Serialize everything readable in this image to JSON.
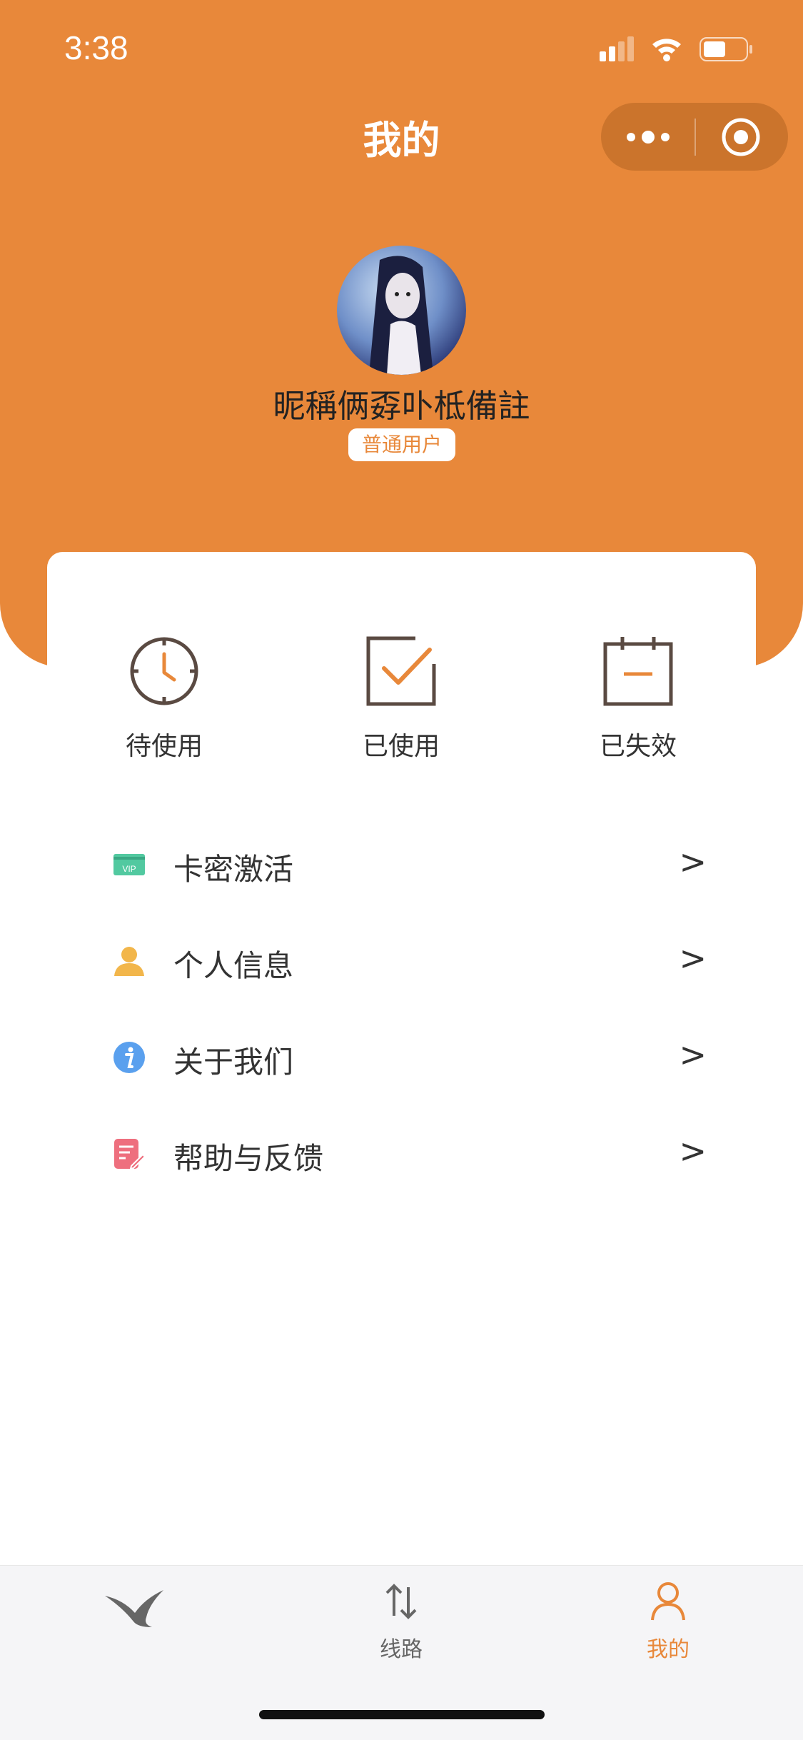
{
  "status_bar": {
    "time": "3:38"
  },
  "nav": {
    "title": "我的"
  },
  "profile": {
    "nickname": "昵稱俩孬卟柢備註",
    "badge": "普通用户"
  },
  "stats": [
    {
      "label": "待使用",
      "icon": "clock-icon"
    },
    {
      "label": "已使用",
      "icon": "checkbox-icon"
    },
    {
      "label": "已失效",
      "icon": "calendar-icon"
    }
  ],
  "menu": [
    {
      "label": "卡密激活",
      "icon": "vip-card-icon",
      "arrow": ">"
    },
    {
      "label": "个人信息",
      "icon": "user-icon",
      "arrow": ">"
    },
    {
      "label": "关于我们",
      "icon": "info-icon",
      "arrow": ">"
    },
    {
      "label": "帮助与反馈",
      "icon": "feedback-icon",
      "arrow": ">"
    }
  ],
  "tabbar": {
    "items": [
      {
        "label": "",
        "icon": "bird-icon"
      },
      {
        "label": "线路",
        "icon": "route-icon"
      },
      {
        "label": "我的",
        "icon": "person-icon",
        "active": true
      }
    ]
  },
  "colors": {
    "accent": "#E8883A",
    "text": "#333333",
    "tab_bg": "#F5F5F7"
  }
}
